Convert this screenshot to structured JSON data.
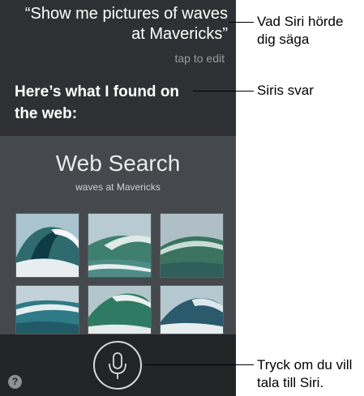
{
  "siri": {
    "heard_quote": "“Show me pictures of waves at Mavericks”",
    "tap_to_edit": "tap to edit",
    "answer": "Here’s what I found on the web:",
    "web_search": {
      "title": "Web Search",
      "query": "waves at Mavericks"
    },
    "help_label": "?",
    "images": [
      "wave photo",
      "wave photo",
      "wave photo",
      "wave photo",
      "wave photo",
      "wave photo"
    ]
  },
  "callouts": {
    "heard": "Vad Siri hörde dig säga",
    "response": "Siris svar",
    "mic": "Tryck om du vill tala till Siri."
  },
  "icons": {
    "mic": "microphone-icon",
    "help": "question-icon"
  },
  "colors": {
    "screen_bg": "#2f3033",
    "card_bg": "#45484c",
    "bottom_bar": "#232426"
  }
}
